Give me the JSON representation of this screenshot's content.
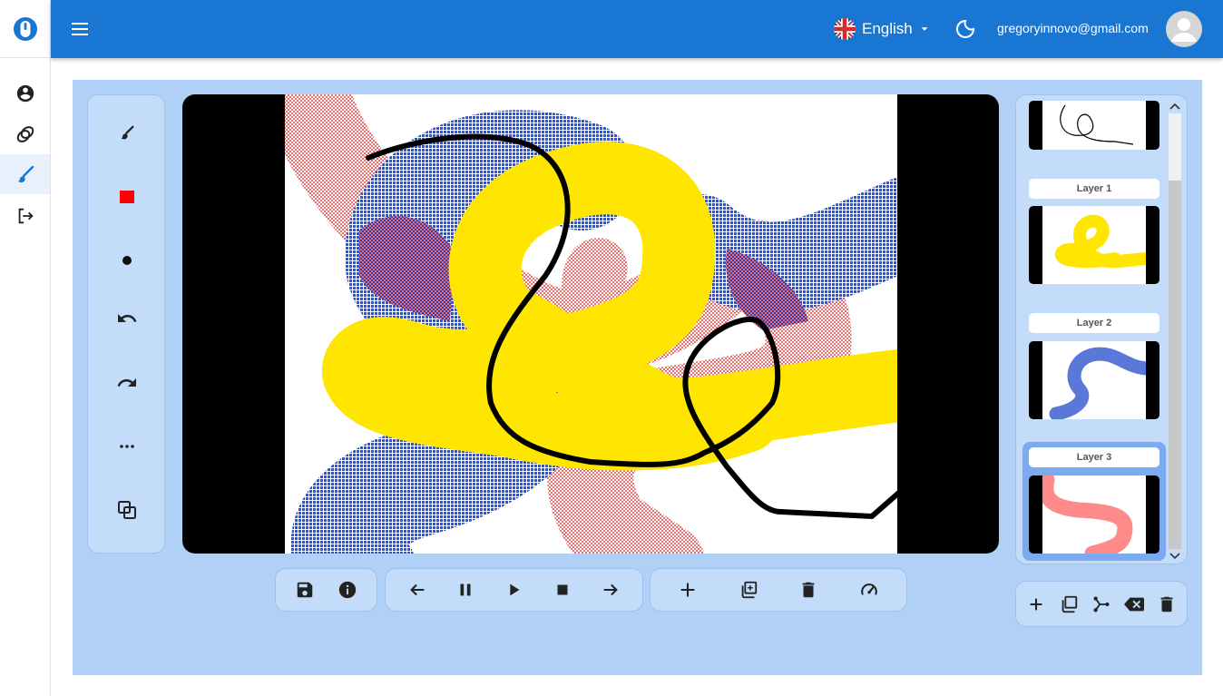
{
  "app": {
    "logo_icon": "mouse-logo-icon",
    "accent": "#1976d2",
    "workspace_bg": "#b0d1f5"
  },
  "nav": {
    "items": [
      "profile-icon",
      "palette-icon",
      "brush-icon",
      "logout-icon"
    ],
    "active": "brush"
  },
  "header": {
    "language": "English",
    "email": "gregoryinnovo@gmail.com"
  },
  "tools": {
    "items": [
      "brush-icon",
      "color-swatch",
      "brush-size-dot",
      "undo-icon",
      "redo-icon",
      "more-icon",
      "layers-icon"
    ],
    "current_color": "#ff0000"
  },
  "playback": {
    "file_group": [
      "save-icon",
      "info-icon"
    ],
    "playback_group": [
      "step-back-icon",
      "pause-icon",
      "play-icon",
      "stop-icon",
      "step-forward-icon"
    ],
    "frame_group": [
      "add-icon",
      "duplicate-icon",
      "delete-icon",
      "speed-icon"
    ]
  },
  "layers": {
    "items": [
      {
        "label": "Layer 1"
      },
      {
        "label": "Layer 2"
      },
      {
        "label": "Layer 3"
      }
    ],
    "selected": "Layer 3",
    "actions": [
      "add-layer-icon",
      "duplicate-layer-icon",
      "merge-layer-icon",
      "clear-layer-icon",
      "delete-layer-icon"
    ]
  }
}
